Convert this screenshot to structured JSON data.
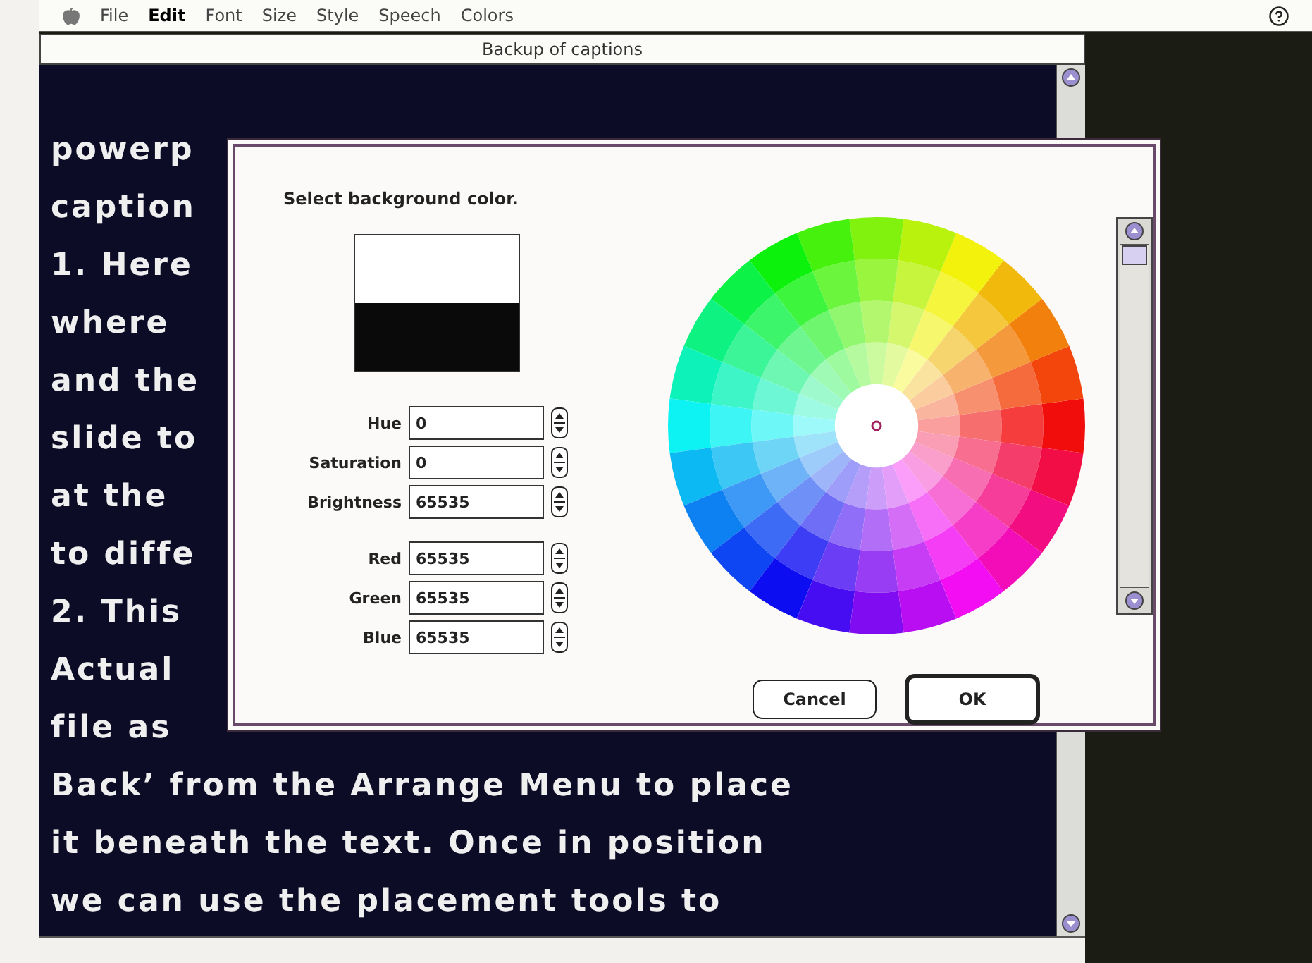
{
  "menu_bar": {
    "items": [
      {
        "label": "File",
        "selected": false
      },
      {
        "label": "Edit",
        "selected": true
      },
      {
        "label": "Font",
        "selected": false
      },
      {
        "label": "Size",
        "selected": false
      },
      {
        "label": "Style",
        "selected": false
      },
      {
        "label": "Speech",
        "selected": false
      },
      {
        "label": "Colors",
        "selected": false
      }
    ]
  },
  "window": {
    "title": "Backup of captions"
  },
  "document": {
    "lines": [
      "powerp",
      "caption",
      "1. Here",
      "where",
      "and the",
      "slide to",
      "at the",
      "to diffe",
      "2. This",
      "Actual",
      "file as",
      "Back’ from the Arrange Menu to place",
      "it beneath the text. Once in position",
      "we can use the placement tools to"
    ]
  },
  "dialog": {
    "prompt": "Select background color.",
    "brightness": {
      "level": 1
    },
    "fields": [
      {
        "label": "Hue",
        "value": "0"
      },
      {
        "label": "Saturation",
        "value": "0"
      },
      {
        "label": "Brightness",
        "value": "65535"
      },
      {
        "label": "Red",
        "value": "65535"
      },
      {
        "label": "Green",
        "value": "65535"
      },
      {
        "label": "Blue",
        "value": "65535"
      }
    ],
    "buttons": [
      {
        "label": "Cancel",
        "default": false
      },
      {
        "label": "OK",
        "default": true
      }
    ]
  }
}
